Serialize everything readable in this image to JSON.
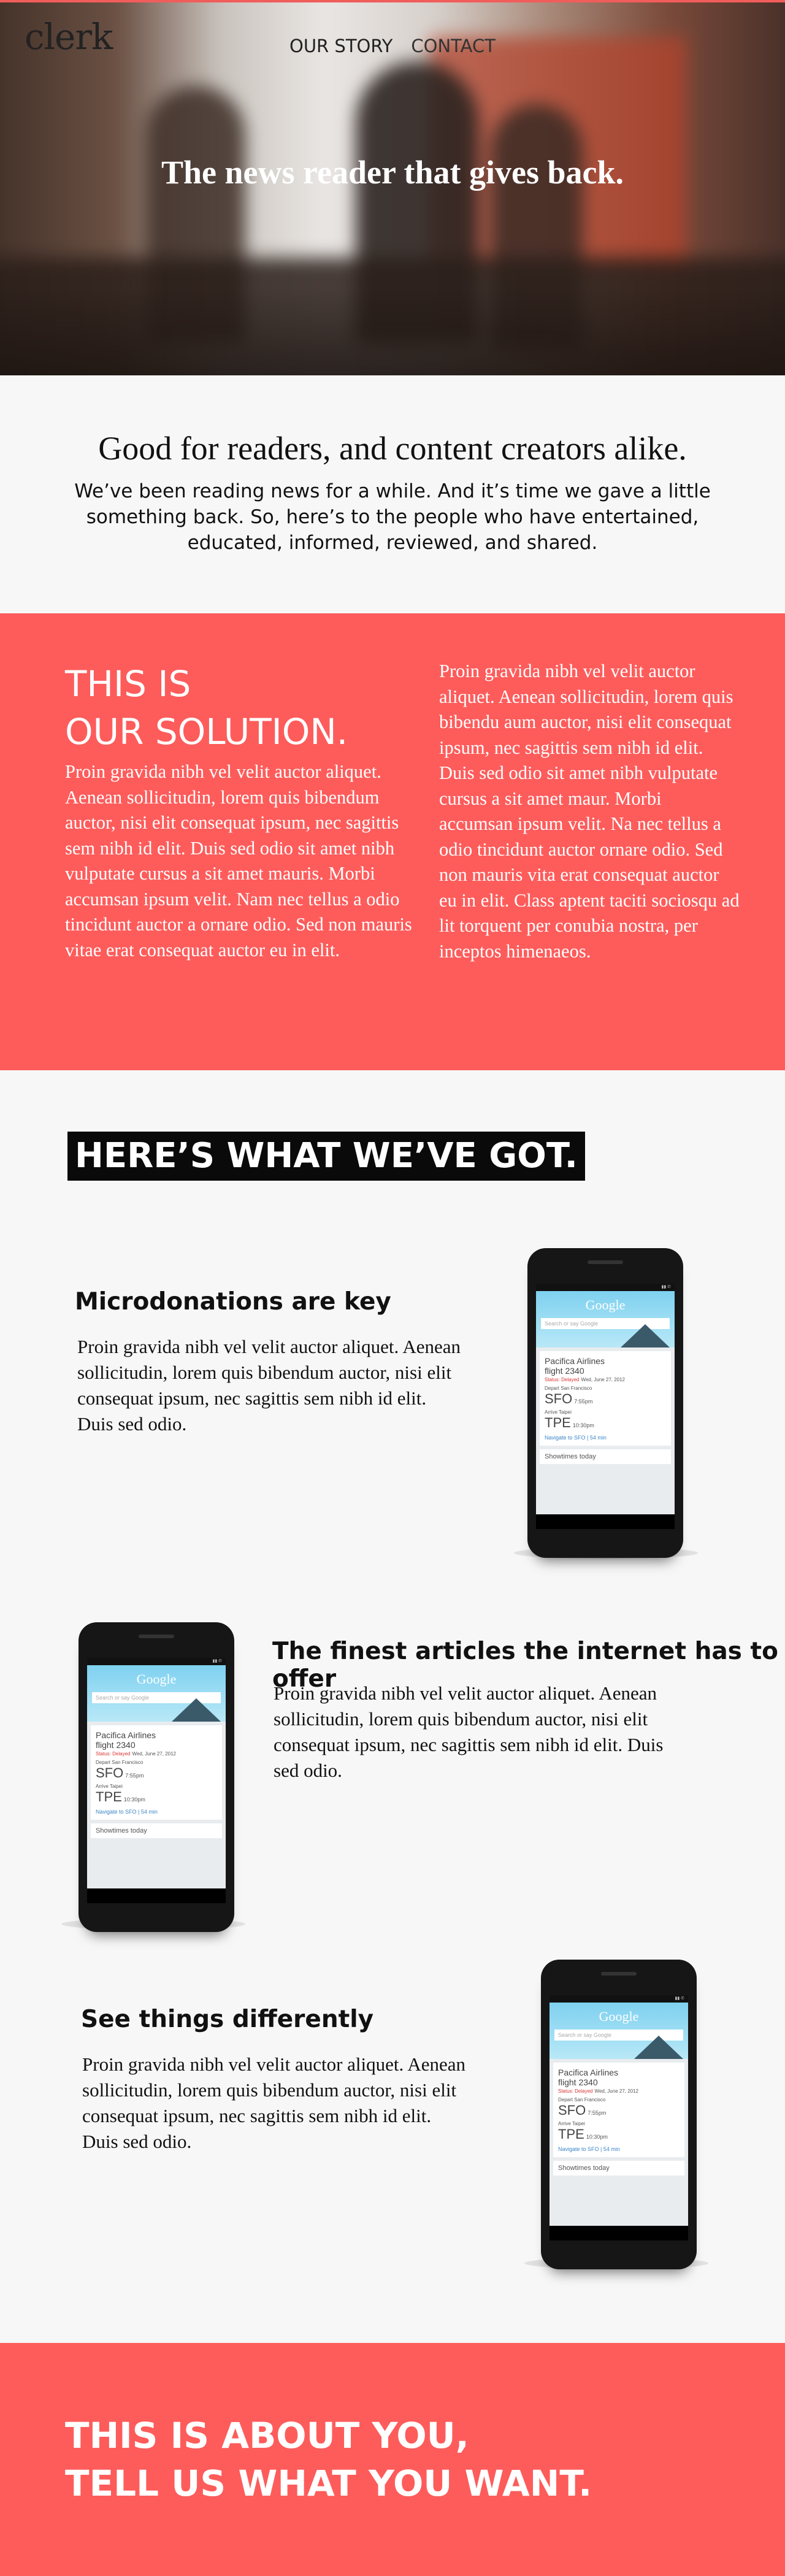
{
  "brand": {
    "logo": "clerk",
    "accent": "#fd5c5b"
  },
  "nav": {
    "items": [
      "OUR STORY",
      "CONTACT"
    ]
  },
  "hero": {
    "title": "The news reader that gives back."
  },
  "intro": {
    "heading": "Good for readers, and content creators alike.",
    "body": "We’ve been reading news for a while. And it’s time we gave a little something back. So, here’s to the people who have entertained, educated, informed, reviewed, and shared."
  },
  "solution": {
    "title_line1": "THIS IS",
    "title_line2": "OUR SOLUTION.",
    "left_text": "Proin gravida nibh vel velit auctor aliquet. Aenean sollicitudin, lorem quis bibendum auctor, nisi elit consequat ipsum, nec sagittis sem nibh id elit. Duis sed odio sit amet nibh vulputate cursus a sit amet mauris. Morbi accumsan ipsum velit. Nam nec tellus a odio tincidunt auctor a ornare odio. Sed non  mauris vitae erat consequat auctor eu in elit.",
    "right_text": "Proin gravida nibh vel velit auctor aliquet. Aenean sollicitudin, lorem quis bibendu aum auctor, nisi elit consequat ipsum, nec sagittis sem nibh id elit. Duis sed odio sit amet nibh vulputate cursus a sit amet maur. Morbi accumsan ipsum velit. Na nec tellus a odio tincidunt auctor ornare odio. Sed non  mauris vita erat consequat auctor eu in elit. Class aptent taciti sociosqu ad lit torquent per conubia nostra, per inceptos himenaeos."
  },
  "features": {
    "heading": "HERE’S WHAT WE’VE GOT.",
    "items": [
      {
        "title": "Microdonations are key",
        "text": "Proin gravida nibh vel velit auctor aliquet. Aenean sollicitudin, lorem quis bibendum auctor, nisi elit consequat ipsum, nec sagittis sem nibh id elit. Duis sed odio."
      },
      {
        "title": "The finest articles the internet has to offer",
        "text": "Proin gravida nibh vel velit auctor aliquet. Aenean sollicitudin, lorem quis bibendum auctor, nisi elit consequat ipsum, nec sagittis sem nibh id elit. Duis sed odio."
      },
      {
        "title": "See things differently",
        "text": "Proin gravida nibh vel velit auctor aliquet. Aenean sollicitudin, lorem quis bibendum auctor, nisi elit consequat ipsum, nec sagittis sem nibh id elit. Duis sed odio."
      }
    ]
  },
  "phone": {
    "google": "Google",
    "search": "Search or say Google",
    "airline": "Pacifica Airlines",
    "flight": "flight 2340",
    "status": "Status: Delayed",
    "date": "Wed, June 27, 2012",
    "depart_label": "Depart San Francisco",
    "from_code": "SFO",
    "from_time": "7:55pm",
    "arrive_label": "Arrive Taipei",
    "to_code": "TPE",
    "to_time": "10:30pm",
    "navigate": "Navigate to SFO  |  54 min",
    "footer": "Showtimes today"
  },
  "cta": {
    "line1": "THIS IS ABOUT YOU,",
    "line2": "TELL US WHAT YOU WANT."
  }
}
